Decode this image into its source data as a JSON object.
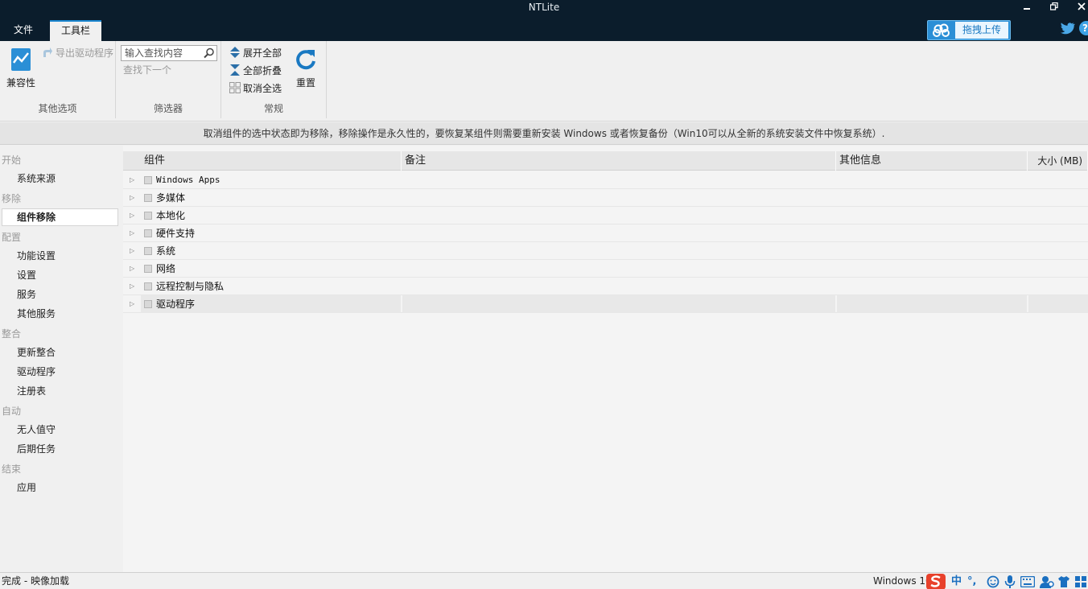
{
  "window": {
    "title": "NTLite"
  },
  "menu": {
    "tabs": [
      {
        "label": "文件"
      },
      {
        "label": "工具栏"
      }
    ]
  },
  "upload": {
    "label": "拖拽上传"
  },
  "help": {
    "label": "?"
  },
  "ribbon": {
    "compat_label": "兼容性",
    "export_drivers_label": "导出驱动程序",
    "group_other_label": "其他选项",
    "search_placeholder": "输入查找内容",
    "find_next_label": "查找下一个",
    "group_filter_label": "筛选器",
    "expand_all_label": "展开全部",
    "collapse_all_label": "全部折叠",
    "deselect_all_label": "取消全选",
    "group_general_label": "常规",
    "reset_label": "重置"
  },
  "infobar": {
    "text": "取消组件的选中状态即为移除，移除操作是永久性的，要恢复某组件则需要重新安装 Windows 或者恢复备份（Win10可以从全新的系统安装文件中恢复系统）."
  },
  "sidebar": {
    "sections": [
      {
        "label": "开始",
        "items": [
          {
            "label": "系统来源"
          }
        ]
      },
      {
        "label": "移除",
        "items": [
          {
            "label": "组件移除"
          }
        ]
      },
      {
        "label": "配置",
        "items": [
          {
            "label": "功能设置"
          },
          {
            "label": "设置"
          },
          {
            "label": "服务"
          },
          {
            "label": "其他服务"
          }
        ]
      },
      {
        "label": "整合",
        "items": [
          {
            "label": "更新整合"
          },
          {
            "label": "驱动程序"
          },
          {
            "label": "注册表"
          }
        ]
      },
      {
        "label": "自动",
        "items": [
          {
            "label": "无人值守"
          },
          {
            "label": "后期任务"
          }
        ]
      },
      {
        "label": "结束",
        "items": [
          {
            "label": "应用"
          }
        ]
      }
    ]
  },
  "table": {
    "columns": [
      {
        "label": "组件"
      },
      {
        "label": "备注"
      },
      {
        "label": "其他信息"
      },
      {
        "label": "大小 (MB)"
      }
    ],
    "rows": [
      {
        "label": "Windows Apps"
      },
      {
        "label": "多媒体"
      },
      {
        "label": "本地化"
      },
      {
        "label": "硬件支持"
      },
      {
        "label": "系统"
      },
      {
        "label": "网络"
      },
      {
        "label": "远程控制与隐私"
      },
      {
        "label": "驱动程序"
      }
    ]
  },
  "status": {
    "left": "完成 - 映像加载",
    "right": "Windows 10"
  },
  "ime": {
    "lang": "中",
    "punct": "°,"
  },
  "colors": {
    "titlebar": "#0b1d2c",
    "accent": "#1a86d0",
    "upload": "#2b8fd6"
  }
}
